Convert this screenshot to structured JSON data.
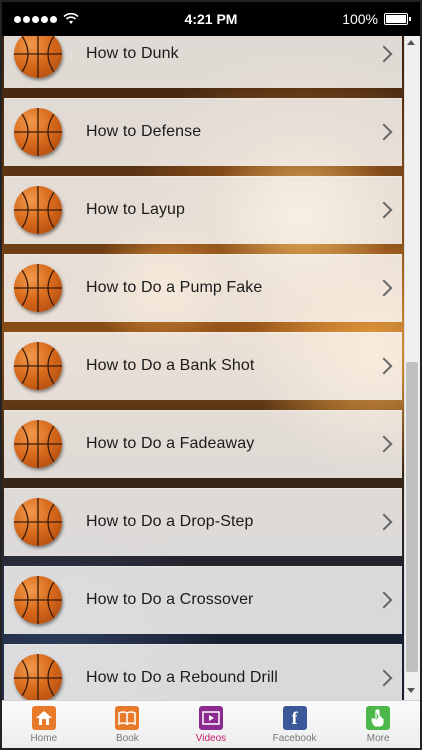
{
  "status_bar": {
    "time": "4:21 PM",
    "battery": "100%",
    "signal_icon": "signal-dots-icon",
    "wifi_icon": "wifi-icon",
    "battery_icon": "battery-icon"
  },
  "list": {
    "items": [
      {
        "label": "How to Dunk"
      },
      {
        "label": "How to Defense"
      },
      {
        "label": "How to Layup"
      },
      {
        "label": "How to Do a Pump Fake"
      },
      {
        "label": "How to Do a Bank Shot"
      },
      {
        "label": "How to Do a Fadeaway"
      },
      {
        "label": "How to Do a Drop-Step"
      },
      {
        "label": "How to Do a Crossover"
      },
      {
        "label": "How to Do a Rebound Drill"
      }
    ],
    "item_icon": "basketball-icon",
    "chevron_icon": "chevron-right-icon"
  },
  "tab_bar": {
    "tabs": [
      {
        "label": "Home",
        "icon": "home-icon"
      },
      {
        "label": "Book",
        "icon": "book-icon"
      },
      {
        "label": "Videos",
        "icon": "video-icon",
        "active": true
      },
      {
        "label": "Facebook",
        "icon": "facebook-icon",
        "glyph": "f"
      },
      {
        "label": "More",
        "icon": "hand-icon"
      }
    ]
  },
  "colors": {
    "active_tab": "#c8206c",
    "accent_orange": "#e87a2c"
  }
}
